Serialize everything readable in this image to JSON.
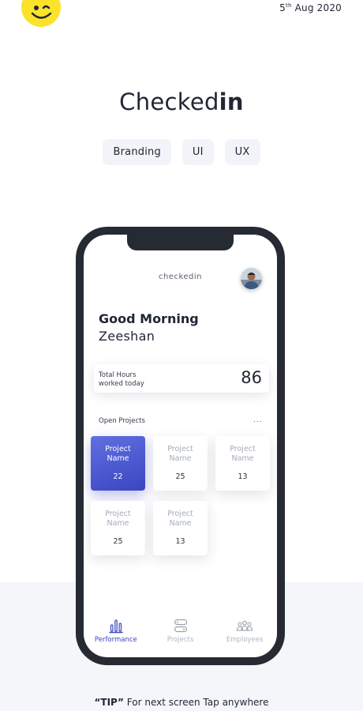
{
  "header": {
    "logo_icon": "winking-smiley-icon",
    "date_day": "5",
    "date_suffix": "th",
    "date_rest": " Aug 2020"
  },
  "project": {
    "title_regular": "Checked",
    "title_bold": "in",
    "tags": [
      "Branding",
      "UI",
      "UX"
    ]
  },
  "app": {
    "name": "checkedin",
    "avatar_icon": "user-avatar",
    "greeting": "Good Morning",
    "user_name": "Zeeshan",
    "hours": {
      "label_line1": "Total Hours",
      "label_line2": "worked today",
      "value": "86"
    },
    "open_projects": {
      "label": "Open Projects",
      "more": "...",
      "items": [
        {
          "name_line1": "Project",
          "name_line2": "Name",
          "count": "22",
          "active": true
        },
        {
          "name_line1": "Project",
          "name_line2": "Name",
          "count": "25",
          "active": false
        },
        {
          "name_line1": "Project",
          "name_line2": "Name",
          "count": "13",
          "active": false
        },
        {
          "name_line1": "Project",
          "name_line2": "Name",
          "count": "25",
          "active": false
        },
        {
          "name_line1": "Project",
          "name_line2": "Name",
          "count": "13",
          "active": false
        }
      ]
    },
    "nav": [
      {
        "label": "Performance",
        "icon": "bar-chart-icon",
        "active": true
      },
      {
        "label": "Projects",
        "icon": "projects-icon",
        "active": false
      },
      {
        "label": "Employees",
        "icon": "employees-icon",
        "active": false
      }
    ]
  },
  "footer": {
    "tip_strong": "“TIP”",
    "tip_rest": " For next screen Tap anywhere"
  },
  "colors": {
    "accent": "#3b46c2",
    "logo_yellow": "#fbe22b",
    "phone_frame": "#262a33",
    "band": "#f4f6fa"
  }
}
